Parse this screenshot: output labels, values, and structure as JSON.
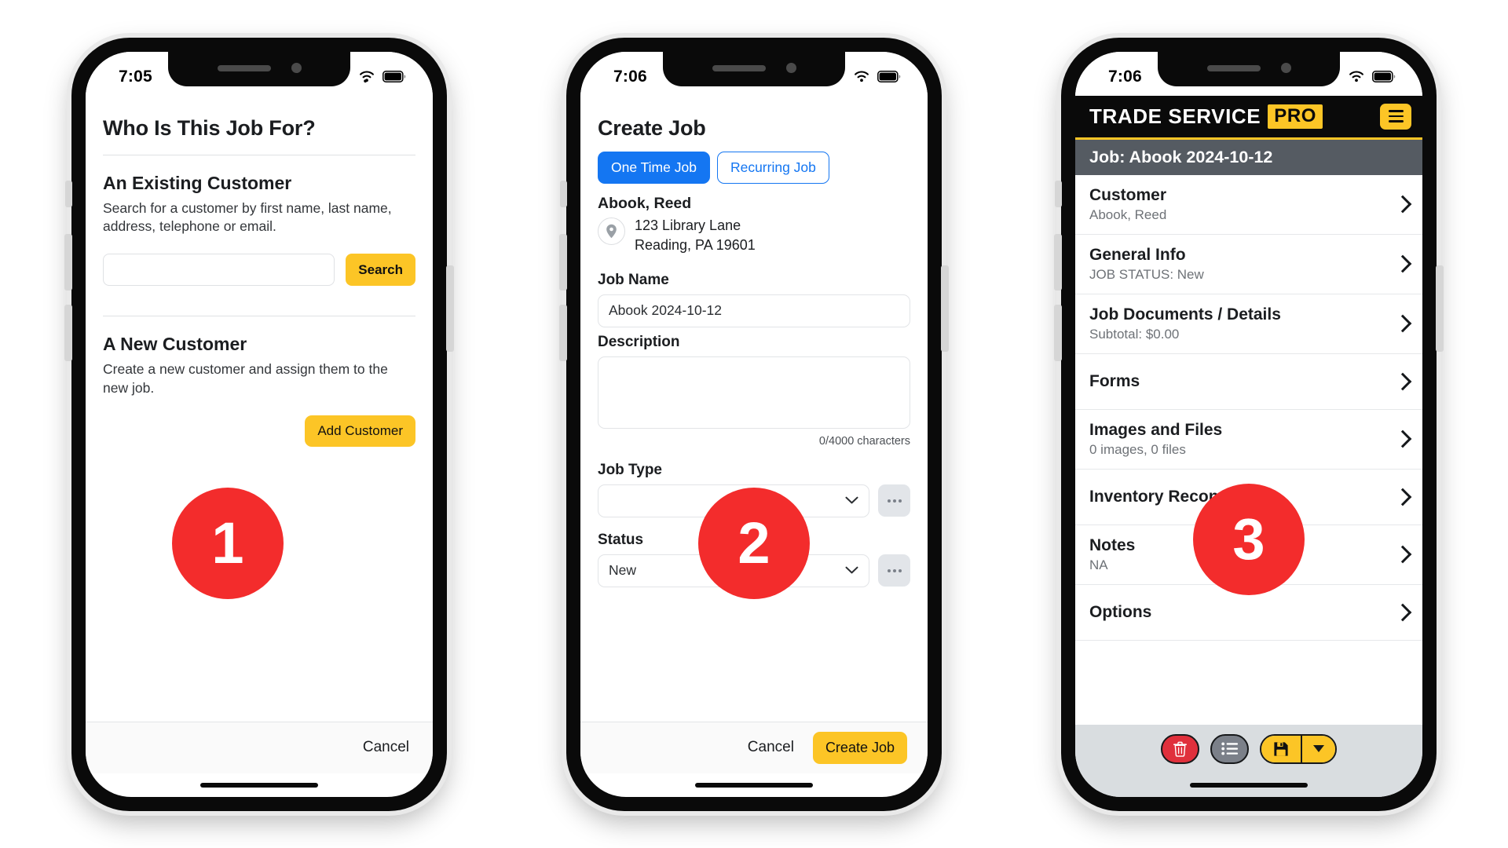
{
  "phones": [
    {
      "step_badge": "1",
      "statusbar": {
        "time": "7:05",
        "wifi_icon": "wifi-icon",
        "battery_icon": "battery-icon"
      },
      "screen": {
        "title": "Who Is This Job For?",
        "existing": {
          "heading": "An Existing Customer",
          "description": "Search for a customer by first name, last name, address, telephone or email.",
          "search_value": "",
          "search_placeholder": "",
          "search_button": "Search"
        },
        "new": {
          "heading": "A New Customer",
          "description": "Create a new customer and assign them to the new job.",
          "add_button": "Add Customer"
        },
        "footer": {
          "cancel": "Cancel"
        }
      }
    },
    {
      "step_badge": "2",
      "statusbar": {
        "time": "7:06",
        "wifi_icon": "wifi-icon",
        "battery_icon": "battery-icon"
      },
      "screen": {
        "title": "Create Job",
        "tabs": [
          {
            "label": "One Time Job",
            "active": true
          },
          {
            "label": "Recurring Job",
            "active": false
          }
        ],
        "customer": {
          "name": "Abook, Reed",
          "address_line1": "123 Library Lane",
          "address_line2": "Reading, PA 19601",
          "pin_icon": "map-pin-icon"
        },
        "fields": {
          "job_name_label": "Job Name",
          "job_name_value": "Abook 2024-10-12",
          "description_label": "Description",
          "description_value": "",
          "char_counter": "0/4000 characters",
          "job_type_label": "Job Type",
          "job_type_value": "",
          "status_label": "Status",
          "status_value": "New",
          "ellipsis_icon": "ellipsis-icon",
          "chevron_icon": "chevron-down-icon"
        },
        "footer": {
          "cancel": "Cancel",
          "primary": "Create Job"
        }
      }
    },
    {
      "step_badge": "3",
      "statusbar": {
        "time": "7:06",
        "wifi_icon": "wifi-icon",
        "battery_icon": "battery-icon"
      },
      "screen": {
        "brand": {
          "name": "TRADE SERVICE",
          "badge": "PRO",
          "menu_icon": "hamburger-menu-icon"
        },
        "job_bar": "Job: Abook 2024-10-12",
        "rows": [
          {
            "title": "Customer",
            "sub": "Abook, Reed"
          },
          {
            "title": "General Info",
            "sub": "JOB STATUS: New"
          },
          {
            "title": "Job Documents / Details",
            "sub": "Subtotal: $0.00"
          },
          {
            "title": "Forms",
            "sub": ""
          },
          {
            "title": "Images and Files",
            "sub": "0 images, 0 files"
          },
          {
            "title": "Inventory Reconciliation",
            "sub": ""
          },
          {
            "title": "Notes",
            "sub": "NA"
          },
          {
            "title": "Options",
            "sub": ""
          }
        ],
        "toolbar": {
          "delete_icon": "trash-icon",
          "list_icon": "list-icon",
          "save_icon": "save-floppy-icon",
          "dropdown_icon": "caret-down-icon"
        }
      }
    }
  ],
  "colors": {
    "accent_yellow": "#fcc526",
    "accent_blue": "#1476f2",
    "badge_red": "#f32c2c",
    "header_black": "#0a0a0a",
    "job_bar_gray": "#555b62",
    "delete_red": "#e0303c"
  }
}
